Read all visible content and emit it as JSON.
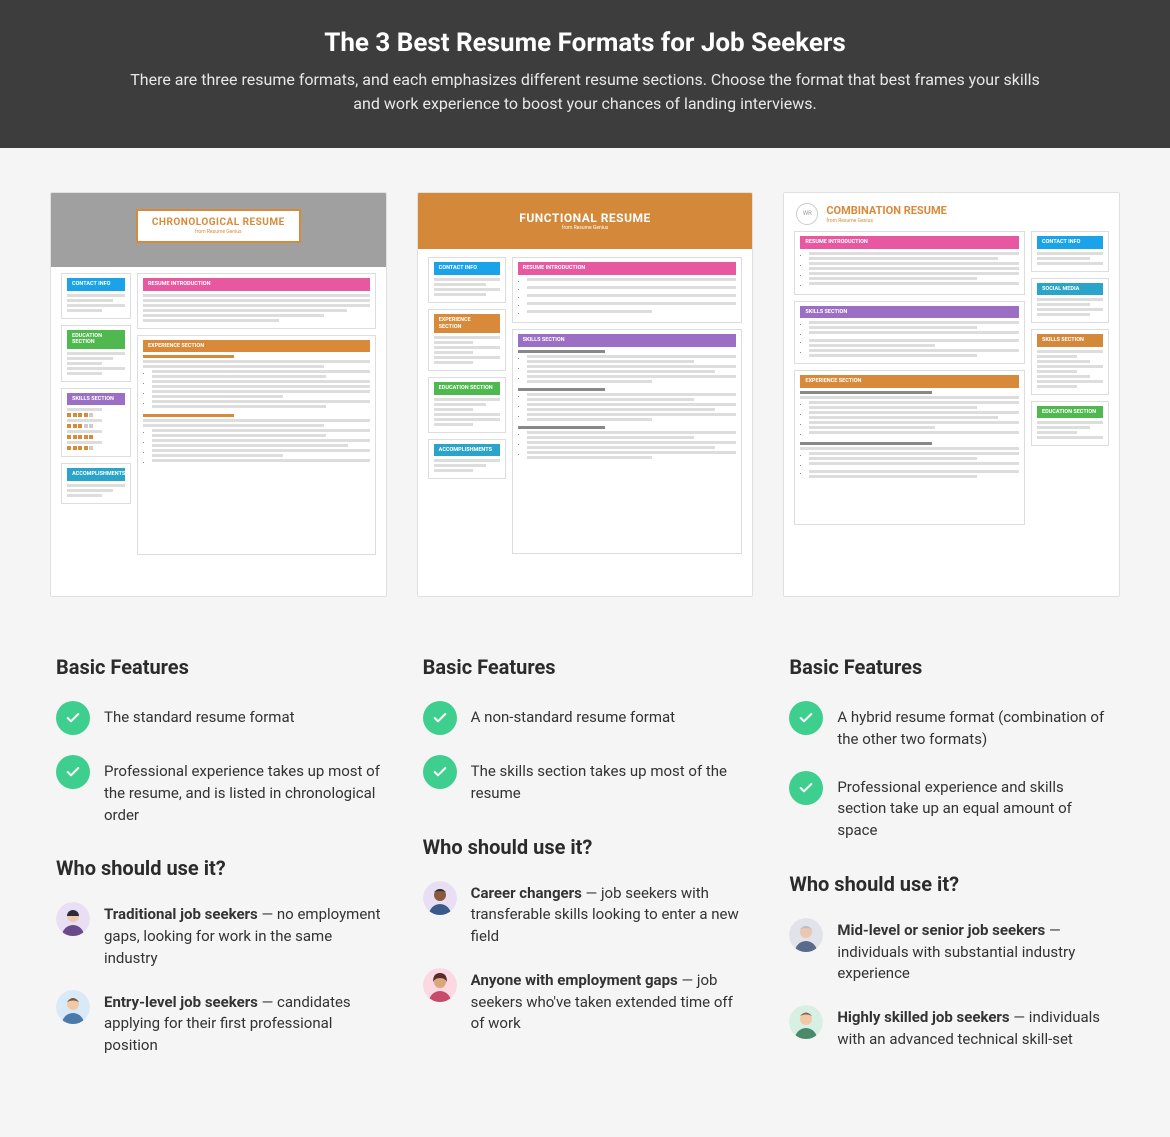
{
  "hero": {
    "title": "The 3 Best Resume Formats for Job Seekers",
    "subtitle": "There are three resume formats, and each emphasizes different resume sections. Choose the format that best frames your skills and work experience to boost your chances of landing interviews."
  },
  "columns": [
    {
      "thumb": {
        "title": "CHRONOLOGICAL RESUME",
        "subtitle": "from Resume Genius"
      },
      "features_heading": "Basic Features",
      "features": [
        "The standard resume format",
        "Professional experience takes up most of the resume, and is listed in chronological order"
      ],
      "who_heading": "Who should use it?",
      "who": [
        {
          "bold": "Traditional job seekers",
          "rest": " — no employment gaps, looking for work in the same industry"
        },
        {
          "bold": "Entry-level job seekers",
          "rest": " — candidates applying for their first professional position"
        }
      ]
    },
    {
      "thumb": {
        "title": "FUNCTIONAL RESUME",
        "subtitle": "from Resume Genius"
      },
      "features_heading": "Basic Features",
      "features": [
        "A non-standard resume format",
        "The skills section takes up most of the resume"
      ],
      "who_heading": "Who should use it?",
      "who": [
        {
          "bold": "Career changers",
          "rest": " — job seekers with transferable skills looking to enter a new field"
        },
        {
          "bold": "Anyone with employment gaps",
          "rest": " — job seekers who've taken extended time off of work"
        }
      ]
    },
    {
      "thumb": {
        "title": "COMBINATION RESUME",
        "subtitle": "from Resume Genius"
      },
      "features_heading": "Basic Features",
      "features": [
        "A hybrid resume format (combination of the other two formats)",
        "Professional experience and skills section take up an equal amount of space"
      ],
      "who_heading": "Who should use it?",
      "who": [
        {
          "bold": "Mid-level or senior job seekers",
          "rest": " — individuals with substantial industry experience"
        },
        {
          "bold": "Highly skilled job seekers",
          "rest": " — individuals with an advanced technical skill-set"
        }
      ]
    }
  ],
  "thumb_labels": {
    "contact": "CONTACT INFO",
    "intro": "RESUME INTRODUCTION",
    "edu": "EDUCATION SECTION",
    "skills": "SKILLS SECTION",
    "exp": "EXPERIENCE SECTION",
    "accomp": "ACCOMPLISHMENTS",
    "social": "SOCIAL MEDIA"
  },
  "avatars": [
    {
      "bg": "#e9dff5",
      "hair": "#2b2b3a",
      "skin": "#f1c9a8"
    },
    {
      "bg": "#d8e9f7",
      "hair": "#7a5a3a",
      "skin": "#f1c9a8"
    },
    {
      "bg": "#e9dff5",
      "hair": "#2b2b3a",
      "skin": "#8a5a3a"
    },
    {
      "bg": "#fcd8e3",
      "hair": "#5a2b2b",
      "skin": "#d9a87a"
    },
    {
      "bg": "#e2e2ea",
      "hair": "#bcbcc4",
      "skin": "#e8c8b0"
    },
    {
      "bg": "#d8f0e4",
      "hair": "#8a6a4a",
      "skin": "#f1c9a8"
    }
  ]
}
